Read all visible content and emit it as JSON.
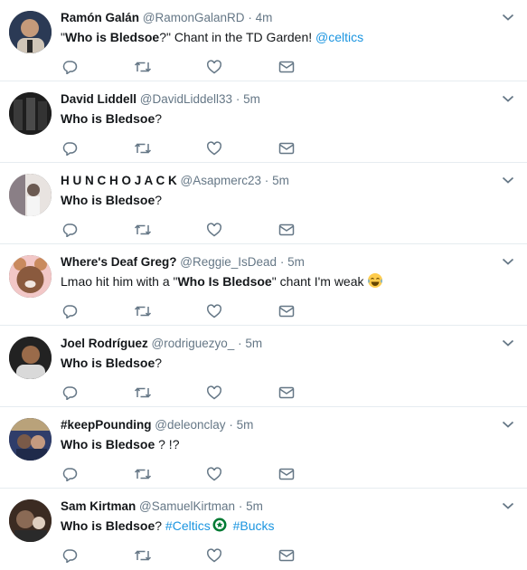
{
  "tweets": [
    {
      "name": "Ramón Galán",
      "handle": "@RamonGalanRD",
      "sep": "·",
      "time": "4m",
      "segments": [
        "\"",
        "Who is Bledsoe",
        "?\" Chant in the TD Garden! ",
        "@celtics"
      ],
      "avatar_colors": [
        "#2b3a55",
        "#d0c6b8"
      ]
    },
    {
      "name": "David Liddell",
      "handle": "@DavidLiddell33",
      "sep": "·",
      "time": "5m",
      "segments": [
        "Who is Bledsoe",
        "?"
      ],
      "avatar_colors": [
        "#1e1e1e",
        "#5a5a5a"
      ]
    },
    {
      "name": "H U N C H O J A C K",
      "handle": "@Asapmerc23",
      "sep": "·",
      "time": "5m",
      "segments": [
        "Who is Bledsoe",
        "?"
      ],
      "avatar_colors": [
        "#7a6d74",
        "#e8e3e0"
      ]
    },
    {
      "name": "Where's Deaf Greg?",
      "handle": "@Reggie_IsDead",
      "sep": "·",
      "time": "5m",
      "segments": [
        "Lmao hit him with a \"",
        "Who Is Bledsoe",
        "\" chant I'm weak "
      ],
      "avatar_colors": [
        "#c98a5e",
        "#f2c7c7"
      ]
    },
    {
      "name": "Joel Rodríguez",
      "handle": "@rodriguezyo_",
      "sep": "·",
      "time": "5m",
      "segments": [
        "Who is Bledsoe",
        "?"
      ],
      "avatar_colors": [
        "#222222",
        "#d9d9d9"
      ]
    },
    {
      "name": "#keepPounding",
      "handle": "@deleonclay",
      "sep": "·",
      "time": "5m",
      "segments": [
        "Who is Bledsoe",
        " ? !?"
      ],
      "avatar_colors": [
        "#2f3d6a",
        "#b9a27a"
      ]
    },
    {
      "name": "Sam Kirtman",
      "handle": "@SamuelKirtman",
      "sep": "·",
      "time": "5m",
      "segments": [
        "Who is Bledsoe",
        "? ",
        "#Celtics",
        " ",
        "#Bucks"
      ],
      "avatar_colors": [
        "#3b2b22",
        "#e0cfc0"
      ]
    }
  ],
  "colors": {
    "accent": "#1b95e0",
    "icon": "#657786",
    "border": "#e6ecf0",
    "celtics": "#007a33"
  },
  "icons": [
    "reply-icon",
    "retweet-icon",
    "like-icon",
    "direct-message-icon",
    "chevron-down-icon",
    "tears-of-joy-emoji",
    "celtics-hashflag-icon"
  ]
}
